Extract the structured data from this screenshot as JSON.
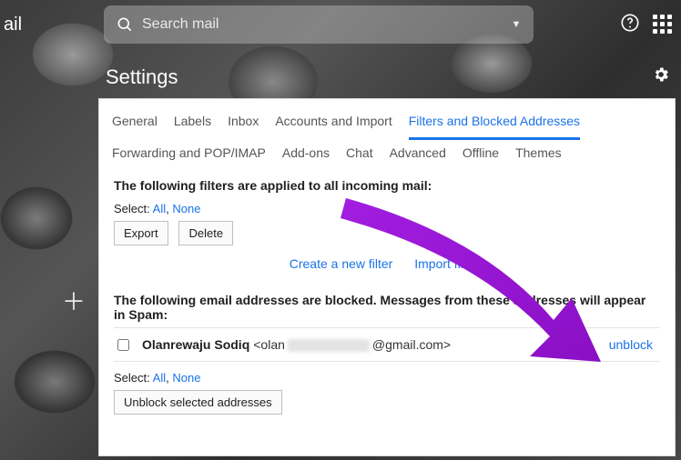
{
  "logo_slice": "ail",
  "search": {
    "placeholder": "Search mail"
  },
  "settings_title": "Settings",
  "tabs": [
    "General",
    "Labels",
    "Inbox",
    "Accounts and Import",
    "Filters and Blocked Addresses",
    "Forwarding and POP/IMAP",
    "Add-ons",
    "Chat",
    "Advanced",
    "Offline",
    "Themes"
  ],
  "active_tab_index": 4,
  "filters": {
    "heading": "The following filters are applied to all incoming mail:",
    "select_label": "Select:",
    "all": "All",
    "none": "None",
    "export_btn": "Export",
    "delete_btn": "Delete",
    "create_link": "Create a new filter",
    "import_link": "Import filters"
  },
  "blocked": {
    "heading": "The following email addresses are blocked. Messages from these addresses will appear in Spam:",
    "row": {
      "name": "Olanrewaju Sodiq",
      "addr_prefix": "<olan",
      "addr_suffix": "@gmail.com>",
      "unblock": "unblock"
    },
    "select_label": "Select:",
    "all": "All",
    "none": "None",
    "unblock_selected": "Unblock selected addresses"
  },
  "colors": {
    "link": "#1a73e8",
    "arrow": "#9b18d8"
  }
}
